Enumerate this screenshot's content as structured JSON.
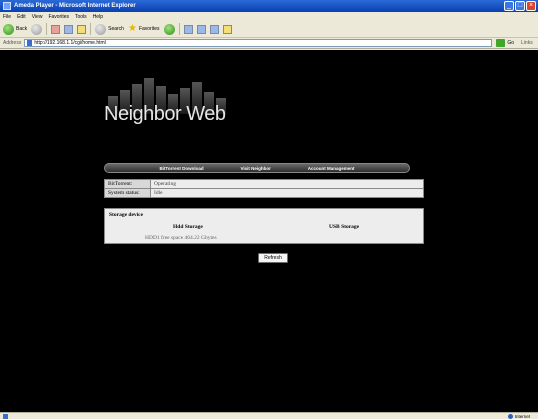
{
  "window": {
    "title": "Ameda Player - Microsoft Internet Explorer",
    "controls": [
      "_",
      "□",
      "×"
    ]
  },
  "menu": [
    "File",
    "Edit",
    "View",
    "Favorites",
    "Tools",
    "Help"
  ],
  "toolbar": {
    "back": "Back",
    "search": "Search",
    "favorites": "Favorites"
  },
  "address": {
    "label": "Address",
    "url": "http://192.168.1.1/cgi/home.html",
    "go": "Go",
    "links": "Links"
  },
  "page": {
    "logo_text": "Neighbor Web",
    "nav": [
      "BitTorrent Download",
      "Visit Neighbor",
      "Account Management"
    ],
    "status_rows": [
      {
        "label": "BitTorrent:",
        "value": "Operating"
      },
      {
        "label": "System status:",
        "value": "Idle"
      }
    ],
    "storage": {
      "title": "Storage device",
      "hdd_label": "Hdd Storage",
      "usb_label": "USB Storage",
      "hdd_info": "HDD1 free space 464.22 Gbytes"
    },
    "refresh_label": "Refresh"
  },
  "statusbar": {
    "zone": "Internet"
  },
  "colors": {
    "titlebar": "#0a3fb0",
    "background": "#000000",
    "panel": "#ededed"
  }
}
